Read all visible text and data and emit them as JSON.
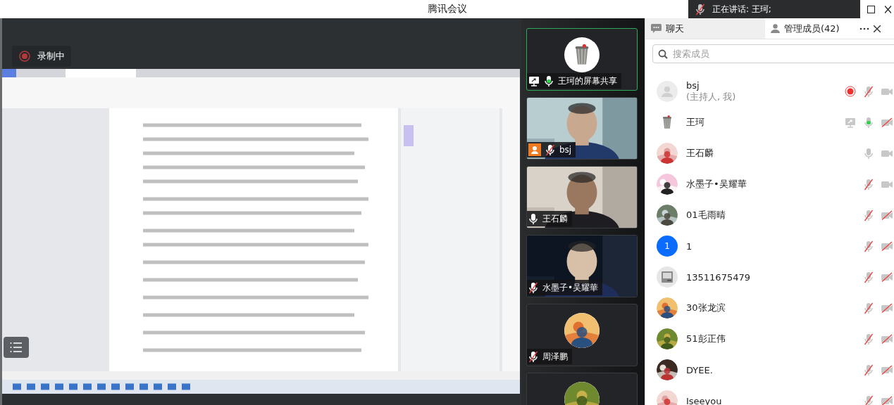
{
  "window": {
    "title": "腾讯会议"
  },
  "speaking_banner": {
    "text": "正在讲话: 王珂;"
  },
  "recording": {
    "label": "录制中"
  },
  "video_tiles": [
    {
      "name": "王珂的屏幕共享",
      "kind": "avatar",
      "avatar": {
        "kind": "trash-can"
      },
      "mic_muted": false,
      "speaking": true,
      "sharing": true,
      "host_badge": false,
      "highlighted": true
    },
    {
      "name": "bsj",
      "kind": "video",
      "mic_muted": true,
      "speaking": false,
      "sharing": false,
      "host_badge": true,
      "highlighted": false
    },
    {
      "name": "王石麟",
      "kind": "video",
      "mic_muted": false,
      "speaking": false,
      "sharing": false,
      "host_badge": false,
      "highlighted": false
    },
    {
      "name": "水墨子•吴耀華",
      "kind": "video",
      "mic_muted": true,
      "speaking": false,
      "sharing": false,
      "host_badge": false,
      "highlighted": false
    },
    {
      "name": "周泽鹏",
      "kind": "avatar",
      "mic_muted": true,
      "speaking": false,
      "sharing": false,
      "host_badge": false,
      "highlighted": false
    },
    {
      "kind": "avatar",
      "highlighted": false
    }
  ],
  "sidebar": {
    "tabs": [
      {
        "label": "聊天",
        "kind": "chat",
        "selected": false
      },
      {
        "label": "管理成员(42)",
        "kind": "members",
        "selected": true
      }
    ],
    "search": {
      "placeholder": "搜索成员"
    },
    "members": [
      {
        "name": "bsj",
        "note": "(主持人, 我)",
        "avatar": {
          "kind": "default"
        },
        "mic_muted": true,
        "speaking": false,
        "camera_on": true,
        "recording": true,
        "sharing": false
      },
      {
        "name": "王珂",
        "avatar": {
          "kind": "trash-can"
        },
        "mic_muted": false,
        "speaking": true,
        "camera_on": false,
        "recording": false,
        "sharing": true
      },
      {
        "name": "王石麟",
        "mic_muted": false,
        "speaking": false,
        "camera_on": true,
        "recording": false,
        "sharing": false
      },
      {
        "name": "水墨子•吴耀華",
        "mic_muted": true,
        "speaking": false,
        "camera_on": true,
        "recording": false,
        "sharing": false
      },
      {
        "name": "01毛雨晴",
        "mic_muted": true,
        "speaking": false,
        "camera_on": false,
        "recording": false,
        "sharing": false
      },
      {
        "name": "1",
        "avatar": {
          "kind": "letter",
          "text": "1"
        },
        "mic_muted": true,
        "speaking": false,
        "camera_on": false,
        "recording": false,
        "sharing": false
      },
      {
        "name": "13511675479",
        "avatar": {
          "kind": "computer"
        },
        "mic_muted": true,
        "speaking": false,
        "camera_on": false,
        "recording": false,
        "sharing": false
      },
      {
        "name": "30张龙滨",
        "mic_muted": true,
        "speaking": false,
        "camera_on": false,
        "recording": false,
        "sharing": false
      },
      {
        "name": "51彭正伟",
        "mic_muted": true,
        "speaking": false,
        "camera_on": false,
        "recording": false,
        "sharing": false
      },
      {
        "name": "DYEE.",
        "mic_muted": true,
        "speaking": false,
        "camera_on": false,
        "recording": false,
        "sharing": false
      },
      {
        "name": "Iseeyou",
        "mic_muted": true,
        "speaking": false,
        "camera_on": false,
        "recording": false,
        "sharing": false
      }
    ]
  }
}
